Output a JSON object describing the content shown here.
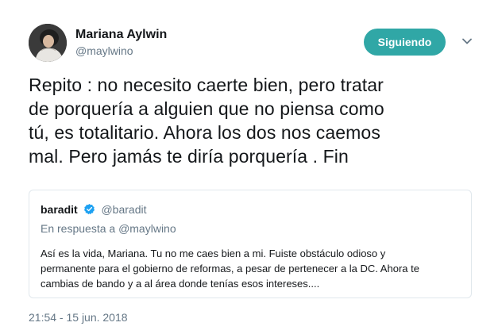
{
  "author": {
    "name": "Mariana Aylwin",
    "handle": "@maylwino"
  },
  "follow_button": {
    "label": "Siguiendo"
  },
  "tweet": {
    "lines": [
      "Repito : no necesito caerte bien, pero tratar",
      "de porquería a alguien que no piensa como",
      "tú, es totalitario. Ahora los dos nos caemos",
      "mal. Pero jamás te diría porquería . Fin"
    ],
    "timestamp": "21:54 - 15 jun. 2018"
  },
  "quoted_tweet": {
    "name": "baradit",
    "handle": "@baradit",
    "reply_prefix": "En respuesta a",
    "reply_to": "@maylwino",
    "lines": [
      "Así es la vida, Mariana. Tu no me caes bien a mi. Fuiste obstáculo odioso y",
      "permanente para el gobierno de reformas, a pesar de pertenecer a la DC. Ahora te",
      "cambias de bando y a al área donde tenías esos intereses...."
    ]
  },
  "colors": {
    "follow_button_bg": "#30a7a6",
    "verified_badge": "#1da1f2",
    "secondary_text": "#657786",
    "border": "#e1e8ed"
  },
  "icons": [
    "avatar-photo",
    "chevron-down-icon",
    "verified-badge-icon"
  ]
}
